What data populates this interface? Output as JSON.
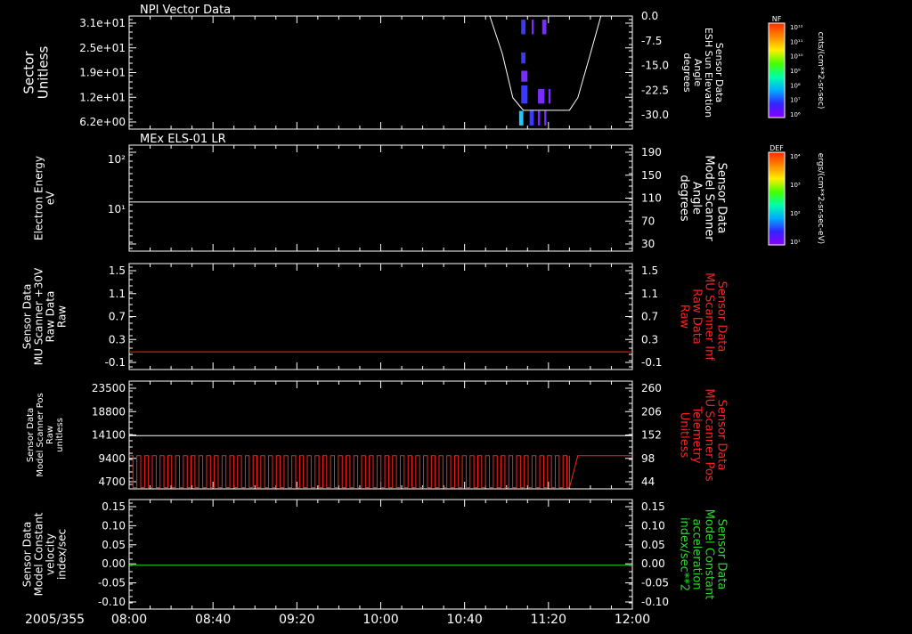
{
  "colors": {
    "background": "#000000",
    "axis": "#ffffff",
    "trace_white": "#ffffff",
    "trace_red": "#ff2020",
    "trace_green": "#22dd22",
    "label_red": "#ff2020",
    "label_green": "#22dd22"
  },
  "time_axis": {
    "date": "2005/355",
    "ticks": [
      "08:00",
      "08:40",
      "09:20",
      "10:00",
      "10:40",
      "11:20",
      "12:00"
    ],
    "start_min": 480,
    "end_min": 720
  },
  "colorbars": [
    {
      "title": "NF",
      "ticks": [
        "10¹²",
        "10¹¹",
        "10¹⁰",
        "10⁹",
        "10⁸",
        "10⁷",
        "10⁶"
      ],
      "unit_label": "cnts/(cm**2-sr-sec)"
    },
    {
      "title": "DEF",
      "ticks": [
        "10⁴",
        "10³",
        "10²",
        "10¹"
      ],
      "unit_label": "ergs/(cm**2-sr-sec-eV)"
    }
  ],
  "chart_data": [
    {
      "type": "heatmap",
      "title": "NPI Vector Data",
      "ylabel": [
        "Sector",
        "Unitless"
      ],
      "y_ticks": [
        "3.1e+01",
        "2.5e+01",
        "1.9e+01",
        "1.2e+01",
        "6.2e+00"
      ],
      "right_ylabel": [
        "Sensor Data",
        "ESH Sun Elevation",
        "Angle",
        "degrees"
      ],
      "right_ticks": [
        "0.0",
        "-7.5",
        "-15.0",
        "-22.5",
        "-30.0"
      ],
      "right_ylim": [
        -36,
        0
      ],
      "overlay_series": {
        "name": "Sensor Data ESH Sun Elevation Angle",
        "x_min": [
          480,
          652,
          658,
          663,
          668,
          690,
          694,
          700,
          705,
          720
        ],
        "y": [
          0,
          0,
          -12,
          -26,
          -30,
          -30,
          -26,
          -12,
          0,
          0
        ]
      },
      "heat_blocks": [
        {
          "t0": 667,
          "t1": 669,
          "sector_lo": 26,
          "sector_hi": 30,
          "level": "blue"
        },
        {
          "t0": 672,
          "t1": 673,
          "sector_lo": 26,
          "sector_hi": 30,
          "level": "violet"
        },
        {
          "t0": 677,
          "t1": 679,
          "sector_lo": 26,
          "sector_hi": 30,
          "level": "violet"
        },
        {
          "t0": 667,
          "t1": 669,
          "sector_lo": 18,
          "sector_hi": 21,
          "level": "blue"
        },
        {
          "t0": 667,
          "t1": 670,
          "sector_lo": 13,
          "sector_hi": 16,
          "level": "violet"
        },
        {
          "t0": 667,
          "t1": 670,
          "sector_lo": 7,
          "sector_hi": 12,
          "level": "blue"
        },
        {
          "t0": 675,
          "t1": 678,
          "sector_lo": 7,
          "sector_hi": 11,
          "level": "violet"
        },
        {
          "t0": 680,
          "t1": 681,
          "sector_lo": 7,
          "sector_hi": 11,
          "level": "violet"
        },
        {
          "t0": 666,
          "t1": 668,
          "sector_lo": 1,
          "sector_hi": 5,
          "level": "cyan"
        },
        {
          "t0": 671,
          "t1": 673,
          "sector_lo": 1,
          "sector_hi": 5,
          "level": "blue"
        },
        {
          "t0": 675,
          "t1": 676,
          "sector_lo": 1,
          "sector_hi": 5,
          "level": "violet"
        },
        {
          "t0": 678,
          "t1": 679,
          "sector_lo": 1,
          "sector_hi": 5,
          "level": "violet"
        }
      ],
      "colorbar": "NF"
    },
    {
      "type": "heatmap",
      "title": "MEx ELS-01 LR",
      "ylabel": [
        "Electron Energy",
        "eV"
      ],
      "y_ticks": [
        "10²",
        "10¹"
      ],
      "y_log": true,
      "right_ylabel": [
        "Sensor Data",
        "Model Scanner",
        "Angle",
        "degrees"
      ],
      "right_ticks": [
        "190",
        "150",
        "110",
        "70",
        "30"
      ],
      "right_ylim": [
        0,
        190
      ],
      "overlay_series": {
        "name": "Sensor Data Model Scanner Angle",
        "x_min": [
          480,
          720
        ],
        "y": [
          88,
          88
        ]
      },
      "colorbar": "DEF"
    },
    {
      "type": "line",
      "ylabel": [
        "Sensor Data",
        "MU Scanner +30V",
        "Raw Data",
        "Raw"
      ],
      "y_ticks": [
        "1.5",
        "1.1",
        "0.7",
        "0.3",
        "-0.1"
      ],
      "ylim": [
        -0.3,
        1.5
      ],
      "right_ylabel": [
        "Sensor Data",
        "MU Scanner Inf",
        "Raw Data",
        "Raw"
      ],
      "right_ticks": [
        "1.5",
        "1.1",
        "0.7",
        "0.3",
        "-0.1"
      ],
      "right_ylim": [
        -0.3,
        1.5
      ],
      "series": [
        {
          "x_min": [
            480,
            720
          ],
          "y": [
            0.0,
            0.0
          ],
          "color": "red",
          "axis": "right"
        }
      ]
    },
    {
      "type": "line",
      "ylabel": [
        "Sensor Data",
        "Model Scanner Pos",
        "Raw",
        "unitless"
      ],
      "y_ticks": [
        "23500",
        "18800",
        "14100",
        "9400",
        "4700"
      ],
      "ylim": [
        0,
        23500
      ],
      "right_ylabel": [
        "Sensor Data",
        "MU Scanner Pos",
        "Telemetry",
        "Unitless"
      ],
      "right_ticks": [
        "260",
        "206",
        "152",
        "98",
        "44"
      ],
      "right_ylim": [
        0,
        260
      ],
      "series": [
        {
          "x_min": [
            480,
            720
          ],
          "y": [
            11600,
            11600
          ],
          "color": "white",
          "axis": "left"
        },
        {
          "color": "red",
          "axis": "right",
          "oscillation": {
            "t_start": 480,
            "t_end": 690,
            "high": 80,
            "low": 3,
            "period_min": 3.2
          },
          "tail": {
            "x_min": [
              690,
              694,
              720
            ],
            "y": [
              3,
              80,
              80
            ]
          }
        }
      ]
    },
    {
      "type": "line",
      "ylabel": [
        "Sensor Data",
        "Model Constant",
        "velocity",
        "index/sec"
      ],
      "y_ticks": [
        "0.15",
        "0.10",
        "0.05",
        "0.00",
        "-0.05",
        "-0.10"
      ],
      "ylim": [
        -0.1,
        0.15
      ],
      "right_ylabel": [
        "Sensor Data",
        "Model Constant",
        "acceleration",
        "index/sec**2"
      ],
      "right_ticks": [
        "0.15",
        "0.10",
        "0.05",
        "0.00",
        "-0.05",
        "-0.10"
      ],
      "right_ylim": [
        -0.1,
        0.15
      ],
      "series": [
        {
          "x_min": [
            480,
            720
          ],
          "y": [
            0.0,
            0.0
          ],
          "color": "green",
          "axis": "right"
        }
      ]
    }
  ]
}
